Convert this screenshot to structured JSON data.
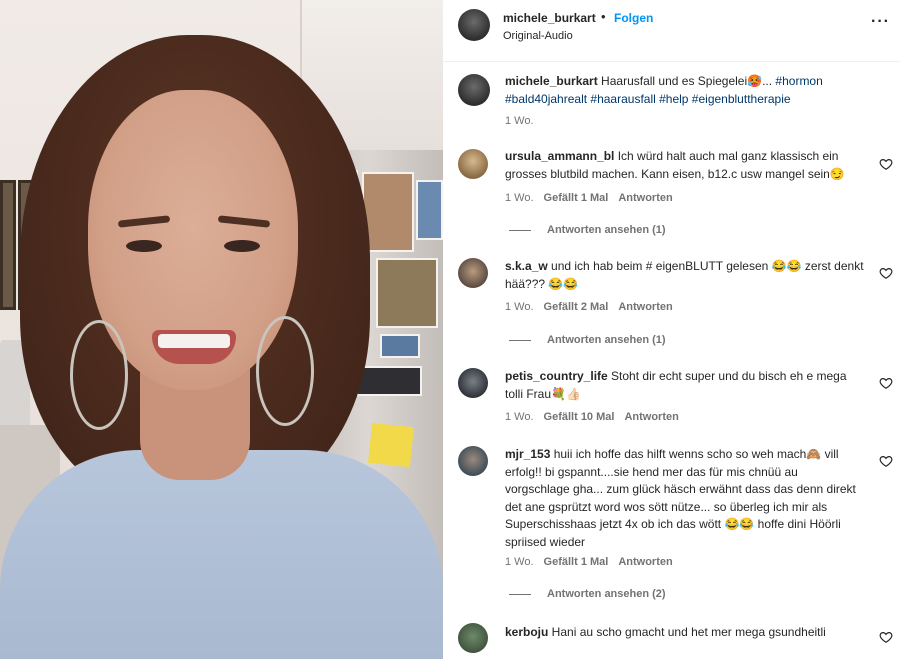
{
  "post": {
    "username": "michele_burkart",
    "separator": "•",
    "follow_label": "Folgen",
    "audio_label": "Original-Audio",
    "more_icon": "more-icon",
    "more_glyph": "···"
  },
  "caption": {
    "username": "michele_burkart",
    "text": " Haarusfall und es Spiegelei🥵... ",
    "tags": "#hormon #bald40jahrealt #haarausfall #help #eigenbluttherapie",
    "time": "1 Wo."
  },
  "comments": [
    {
      "username": "ursula_ammann_bl",
      "text": " Ich würd halt auch mal ganz klassisch ein grosses blutbild machen. Kann eisen, b12.c usw mangel sein😏",
      "time": "1 Wo.",
      "likes": "Gefällt 1 Mal",
      "reply_label": "Antworten",
      "view_replies": "Antworten ansehen (1)"
    },
    {
      "username": "s.k.a_w",
      "text": " und ich hab beim # eigenBLUTT gelesen 😂😂 zerst denkt hää??? 😂😂",
      "time": "1 Wo.",
      "likes": "Gefällt 2 Mal",
      "reply_label": "Antworten",
      "view_replies": "Antworten ansehen (1)"
    },
    {
      "username": "petis_country_life",
      "text": " Stoht dir echt super und du bisch eh e mega tolli Frau💐👍🏻",
      "time": "1 Wo.",
      "likes": "Gefällt 10 Mal",
      "reply_label": "Antworten",
      "view_replies": ""
    },
    {
      "username": "mjr_153",
      "text": " huii ich hoffe das hilft wenns scho so weh mach🙈 vill erfolg!! bi gspannt....sie hend mer das für mis chnüü au vorgschlage gha... zum glück häsch erwähnt dass das denn direkt det ane gsprützt word wos sött nütze... so überleg ich mir als Superschisshaas jetzt 4x ob ich das wött 😂😂 hoffe dini Höörli spriised wieder",
      "time": "1 Wo.",
      "likes": "Gefällt 1 Mal",
      "reply_label": "Antworten",
      "view_replies": "Antworten ansehen (2)"
    },
    {
      "username": "kerboju",
      "text": " Hani au scho gmacht und het mer mega gsundheitli",
      "time": "",
      "likes": "",
      "reply_label": "",
      "view_replies": ""
    }
  ],
  "icons": {
    "like": "heart-icon"
  },
  "colors": {
    "accent": "#0095f6",
    "hashtag": "#00376b",
    "muted": "#737373",
    "text": "#262626"
  }
}
